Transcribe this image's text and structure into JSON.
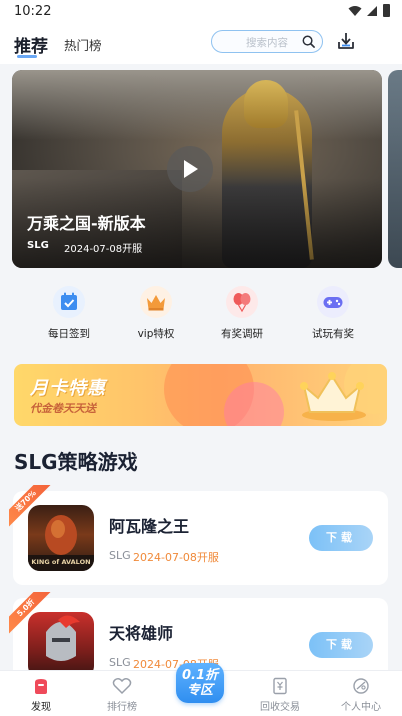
{
  "status_bar": {
    "time": "10:22"
  },
  "header": {
    "tabs": [
      {
        "label": "推荐",
        "active": true
      },
      {
        "label": "热门榜",
        "active": false
      }
    ],
    "search": {
      "placeholder": "搜索内容",
      "icon": "search-icon"
    },
    "download_icon": "download-icon"
  },
  "banner": {
    "title": "万乘之国-新版本",
    "tag": "SLG",
    "date": "2024-07-08开服",
    "play_icon": "play-icon"
  },
  "quick_links": [
    {
      "label": "每日签到",
      "icon": "calendar-check-icon",
      "color": "#3d8df0"
    },
    {
      "label": "vip特权",
      "icon": "crown-icon",
      "color": "#f39a3a"
    },
    {
      "label": "有奖调研",
      "icon": "balloons-icon",
      "color": "#ef5a5a"
    },
    {
      "label": "试玩有奖",
      "icon": "gamepad-icon",
      "color": "#6b6ff2"
    }
  ],
  "promo": {
    "title": "月卡特惠",
    "subtitle": "代金卷天天送",
    "icon": "crown-icon"
  },
  "section": {
    "title": "SLG策略游戏"
  },
  "games": [
    {
      "name": "阿瓦隆之王",
      "tag": "SLG",
      "date": "2024-07-08开服",
      "ribbon": "送70%",
      "icon_caption": "KING of AVALON",
      "download_label": "下载"
    },
    {
      "name": "天将雄师",
      "tag": "SLG",
      "date": "2024-07-08开服",
      "ribbon": "5.0折",
      "download_label": "下载"
    }
  ],
  "tabbar": {
    "items": [
      {
        "label": "发现",
        "icon": "discover-icon",
        "active": true
      },
      {
        "label": "排行榜",
        "icon": "heart-icon",
        "active": false
      },
      {
        "label": "0.1折专区",
        "badge_top": "0.1折",
        "badge_bottom": "专区",
        "icon": "discount-badge-icon",
        "active": false
      },
      {
        "label": "回收交易",
        "icon": "trade-icon",
        "active": false
      },
      {
        "label": "个人中心",
        "icon": "profile-icon",
        "active": false
      }
    ]
  },
  "colors": {
    "accent": "#3d8df0",
    "date_orange": "#f08a3a",
    "download_btn": "#8cc8f7"
  }
}
